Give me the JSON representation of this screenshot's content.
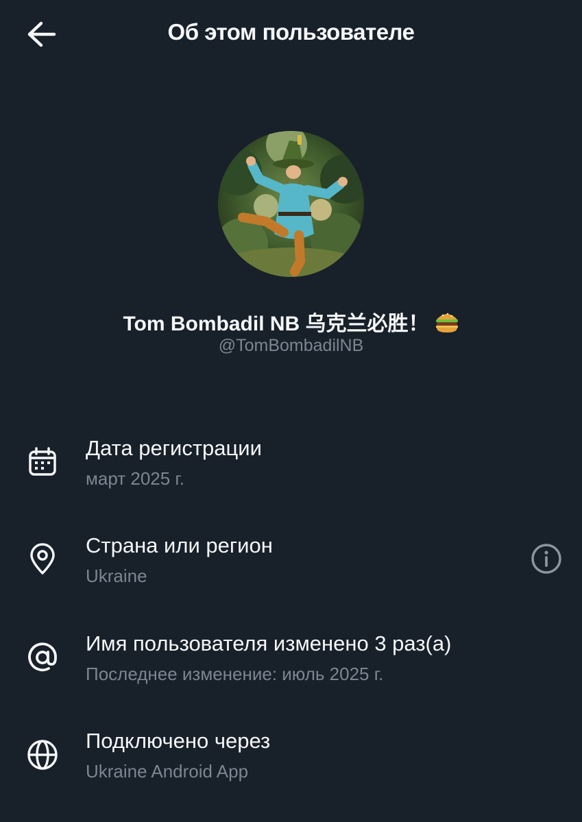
{
  "header": {
    "title": "Об этом пользователе",
    "back_icon": "arrow-left-icon"
  },
  "profile": {
    "display_name": "Tom Bombadil NB 乌克兰必胜！",
    "name_emoji": "burger-icon",
    "handle": "@TomBombadilNB",
    "avatar_icon": "avatar-image"
  },
  "rows": [
    {
      "icon": "calendar-icon",
      "title": "Дата регистрации",
      "value": "март 2025 г."
    },
    {
      "icon": "location-pin-icon",
      "title": "Страна или регион",
      "value": "Ukraine",
      "action_icon": "info-icon"
    },
    {
      "icon": "at-sign-icon",
      "title": "Имя пользователя изменено 3 раз(а)",
      "value": "Последнее изменение: июль 2025 г."
    },
    {
      "icon": "globe-icon",
      "title": "Подключено через",
      "value": "Ukraine Android App"
    }
  ],
  "colors": {
    "background": "#18202a",
    "text_primary": "#f5f7f9",
    "text_secondary": "#7b8691"
  }
}
